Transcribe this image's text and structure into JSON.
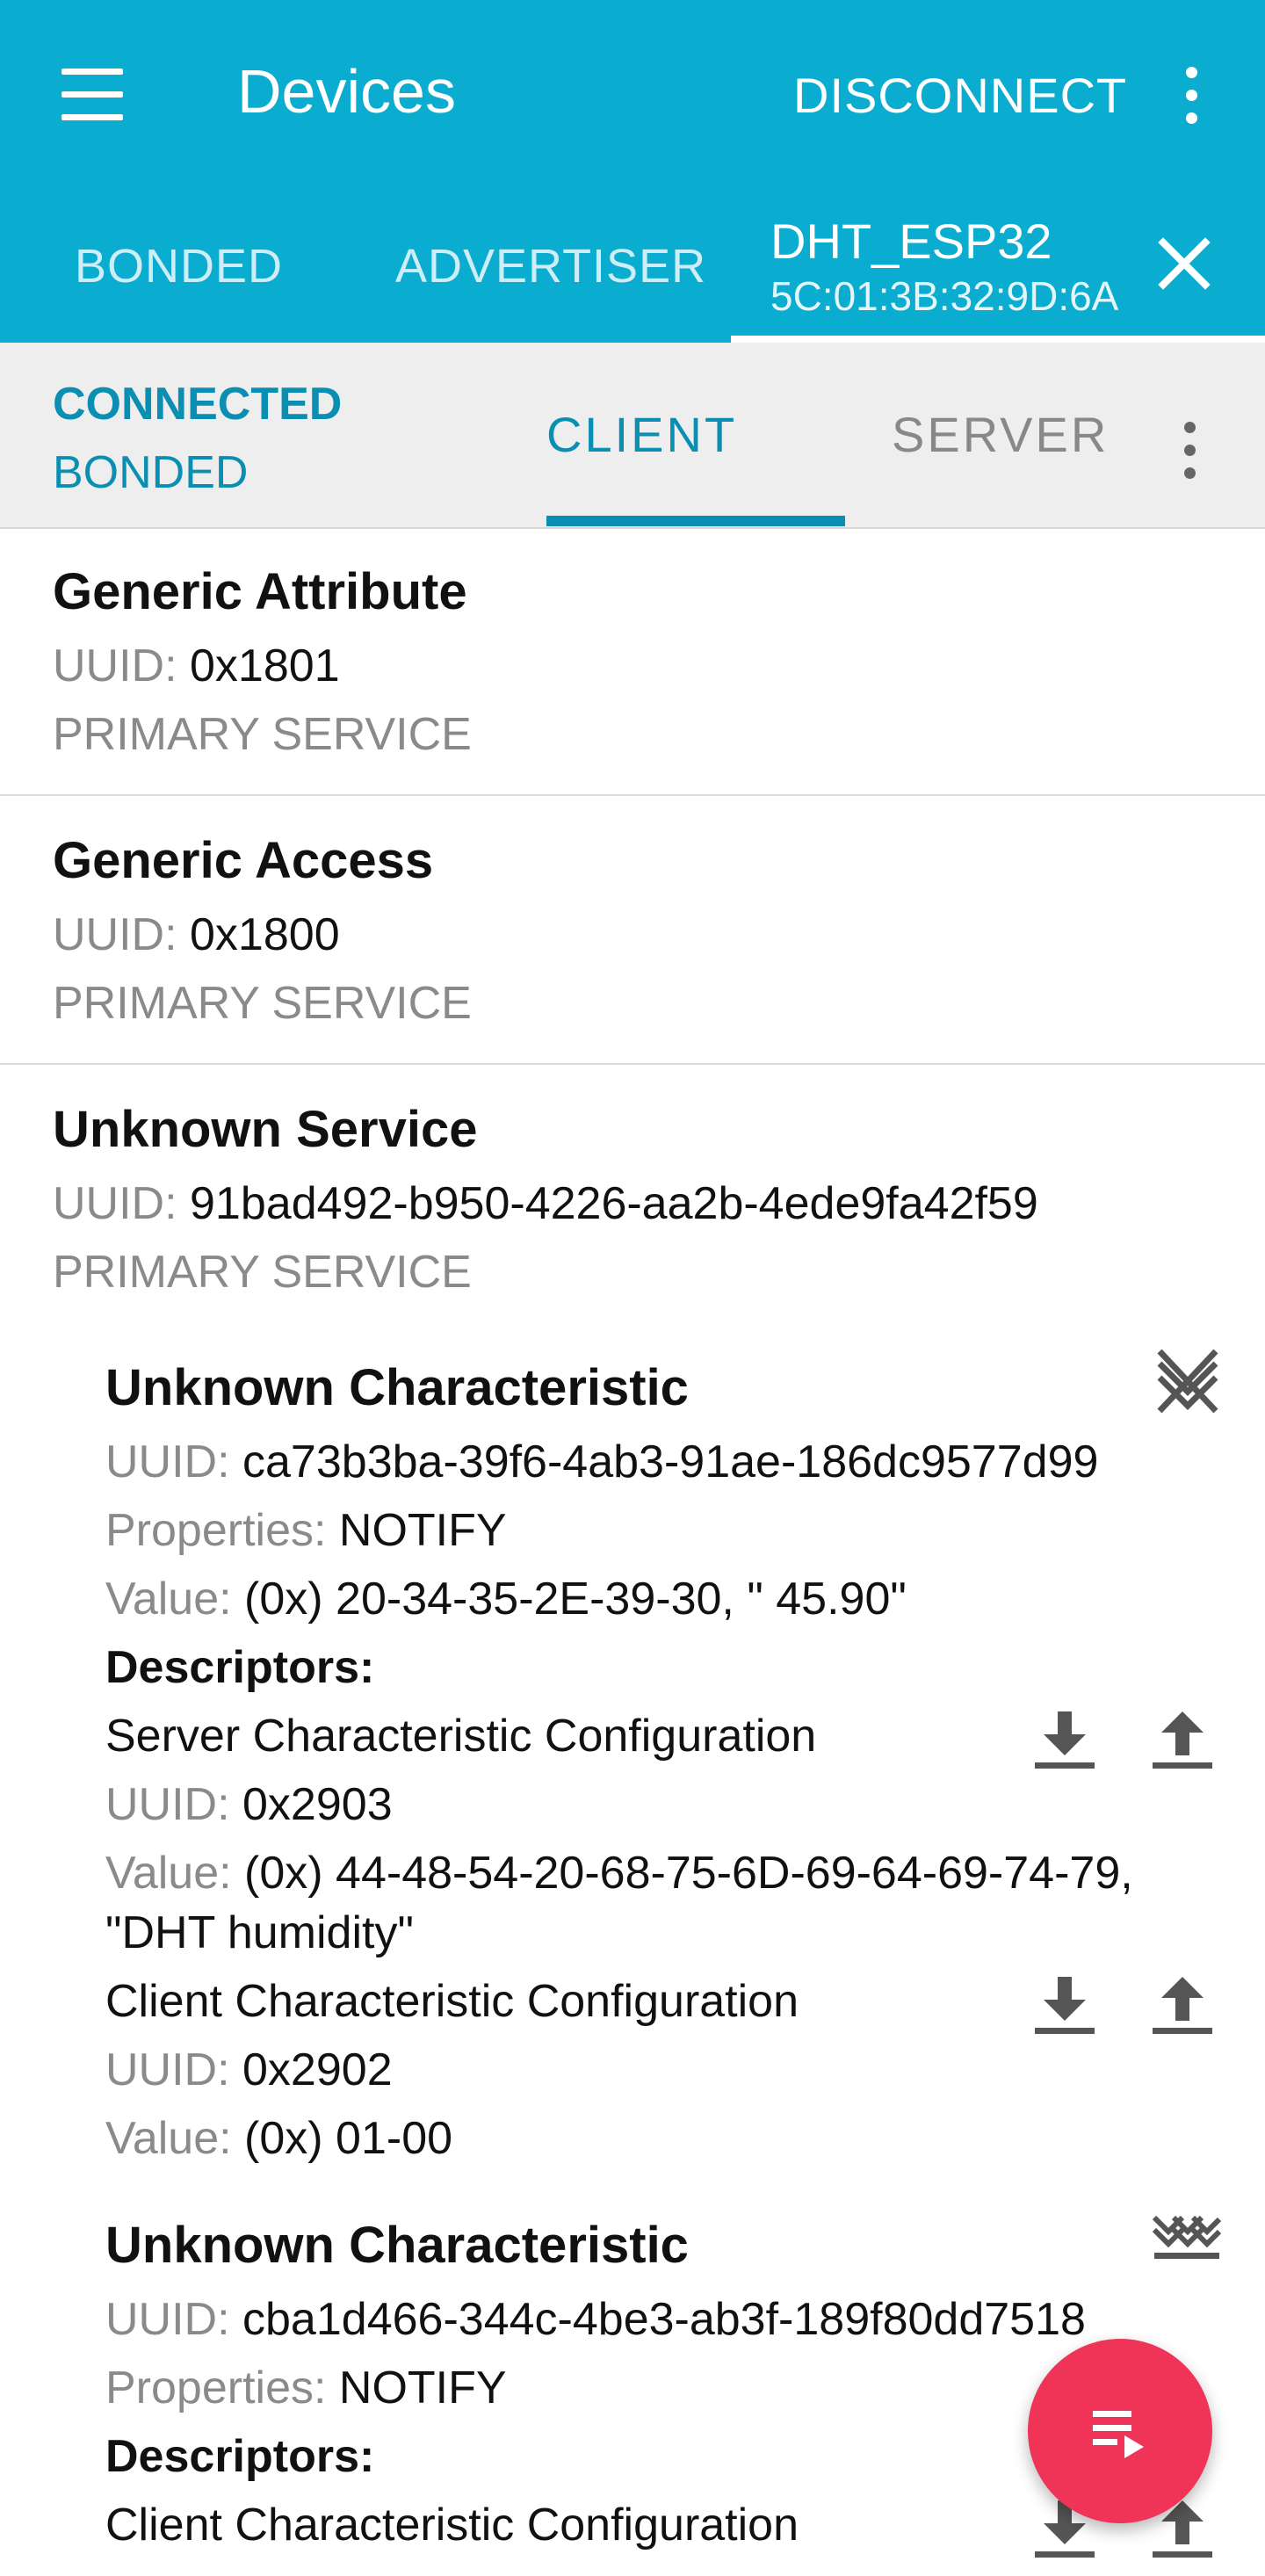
{
  "appbar": {
    "title": "Devices",
    "disconnect_label": "DISCONNECT",
    "tabs": [
      {
        "label": "BONDED"
      },
      {
        "label": "ADVERTISER"
      }
    ],
    "device_tab": {
      "name": "DHT_ESP32",
      "address": "5C:01:3B:32:9D:6A"
    }
  },
  "subbar": {
    "status": "CONNECTED",
    "bond_state": "BONDED",
    "tabs": [
      {
        "label": "CLIENT",
        "active": true
      },
      {
        "label": "SERVER",
        "active": false
      }
    ]
  },
  "labels": {
    "uuid": "UUID:",
    "properties": "Properties:",
    "value": "Value:",
    "descriptors": "Descriptors:"
  },
  "services": [
    {
      "name": "Generic Attribute",
      "uuid": "0x1801",
      "type": "PRIMARY SERVICE"
    },
    {
      "name": "Generic Access",
      "uuid": "0x1800",
      "type": "PRIMARY SERVICE"
    },
    {
      "name": "Unknown Service",
      "uuid": "91bad492-b950-4226-aa2b-4ede9fa42f59",
      "type": "PRIMARY SERVICE",
      "characteristics": [
        {
          "name": "Unknown Characteristic",
          "uuid": "ca73b3ba-39f6-4ab3-91ae-186dc9577d99",
          "properties": "NOTIFY",
          "value": "(0x) 20-34-35-2E-39-30, \" 45.90\"",
          "icon": "notifications-off-icon",
          "descriptors": [
            {
              "name": "Server Characteristic Configuration",
              "uuid": "0x2903",
              "value_line1": "(0x) 44-48-54-20-68-75-6D-69-64-69-74-79,",
              "value_line2": "\"DHT humidity\""
            },
            {
              "name": "Client Characteristic Configuration",
              "uuid": "0x2902",
              "value_line1": "(0x) 01-00"
            }
          ]
        },
        {
          "name": "Unknown Characteristic",
          "uuid": "cba1d466-344c-4be3-ab3f-189f80dd7518",
          "properties": "NOTIFY",
          "icon": "notify-multiple-icon",
          "descriptors": [
            {
              "name": "Client Characteristic Configuration"
            }
          ]
        }
      ]
    }
  ],
  "colors": {
    "primary": "#0aaccf",
    "accent_text": "#0a8fb2",
    "fab": "#ef3458"
  }
}
